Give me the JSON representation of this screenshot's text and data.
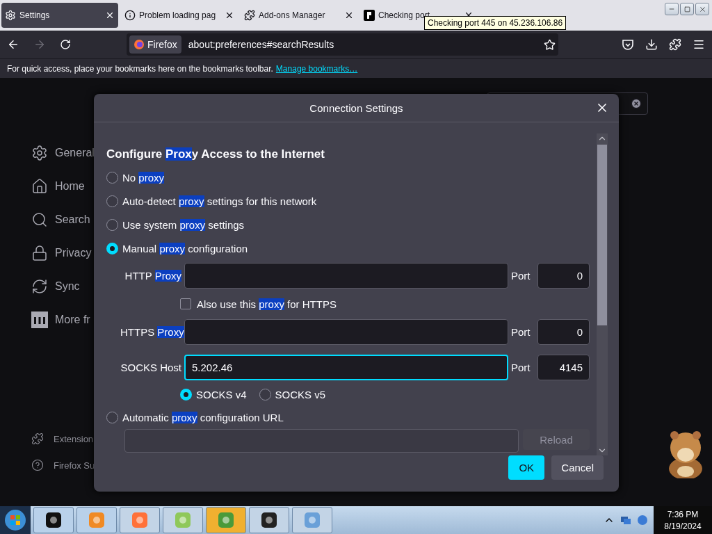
{
  "browser_tabs": [
    {
      "title": "Settings",
      "selected": true
    },
    {
      "title": "Problem loading pag",
      "selected": false
    },
    {
      "title": "Add-ons Manager",
      "selected": false
    },
    {
      "title": "Checking port",
      "selected": false
    }
  ],
  "tooltip": "Checking port 445 on 45.236.106.86",
  "nav": {
    "identity": "Firefox",
    "url": "about:preferences#searchResults"
  },
  "bookmarks_bar": {
    "message": "For quick access, place your bookmarks here on the bookmarks toolbar.",
    "link": "Manage bookmarks…"
  },
  "sidebar": {
    "items": [
      "General",
      "Home",
      "Search",
      "Privacy",
      "Sync",
      "More fr"
    ],
    "footer": [
      "Extension",
      "Firefox Su"
    ]
  },
  "dialog": {
    "title": "Connection Settings",
    "heading": [
      {
        "text": "Configure ",
        "highlight": false
      },
      {
        "text": "Prox",
        "highlight": true
      },
      {
        "text": "y Access to the Internet",
        "highlight": false
      }
    ],
    "modes": [
      {
        "kind": "plain",
        "selected": false,
        "label": [
          {
            "text": "No ",
            "highlight": false
          },
          {
            "text": "proxy",
            "highlight": true
          }
        ]
      },
      {
        "kind": "plain",
        "selected": false,
        "label": [
          {
            "text": "Auto-detect ",
            "highlight": false
          },
          {
            "text": "proxy",
            "highlight": true
          },
          {
            "text": " settings for this network",
            "highlight": false
          }
        ]
      },
      {
        "kind": "plain",
        "selected": false,
        "label": [
          {
            "text": "Use system ",
            "highlight": false
          },
          {
            "text": "proxy",
            "highlight": true
          },
          {
            "text": " settings",
            "highlight": false
          }
        ]
      },
      {
        "kind": "manual",
        "selected": true,
        "label": [
          {
            "text": "Manual ",
            "highlight": false
          },
          {
            "text": "proxy",
            "highlight": true
          },
          {
            "text": " configuration",
            "highlight": false
          }
        ],
        "rows": [
          {
            "kind": "host",
            "label": [
              {
                "text": "HTTP ",
                "highlight": false
              },
              {
                "text": "Proxy",
                "highlight": true
              }
            ],
            "focused": false,
            "port_label": "Port",
            "port": "0"
          },
          {
            "kind": "checkbox",
            "checked": false,
            "label": [
              {
                "text": "Also use this ",
                "highlight": false
              },
              {
                "text": "proxy",
                "highlight": true
              },
              {
                "text": " for HTTPS",
                "highlight": false
              }
            ]
          },
          {
            "kind": "host",
            "label": [
              {
                "text": "HTTPS ",
                "highlight": false
              },
              {
                "text": "Proxy",
                "highlight": true
              }
            ],
            "focused": false,
            "port_label": "Port",
            "port": "0"
          },
          {
            "kind": "host",
            "label": [
              {
                "text": "SOCKS Host",
                "highlight": false
              }
            ],
            "value": "5.202.46",
            "focused": true,
            "port_label": "Port",
            "port": "4145"
          },
          {
            "kind": "versions",
            "options": [
              {
                "label": "SOCKS v4",
                "selected": true
              },
              {
                "label": "SOCKS v5",
                "selected": false
              }
            ]
          }
        ]
      },
      {
        "kind": "url",
        "selected": false,
        "label": [
          {
            "text": "Automatic ",
            "highlight": false
          },
          {
            "text": "proxy",
            "highlight": true
          },
          {
            "text": " configuration URL",
            "highlight": false
          }
        ],
        "button": "Reload",
        "disabled": true
      }
    ],
    "buttons": [
      {
        "label": "OK",
        "primary": true
      },
      {
        "label": "Cancel",
        "primary": false
      }
    ]
  },
  "taskbar": {
    "time": "7:36 PM",
    "date": "8/19/2024"
  }
}
